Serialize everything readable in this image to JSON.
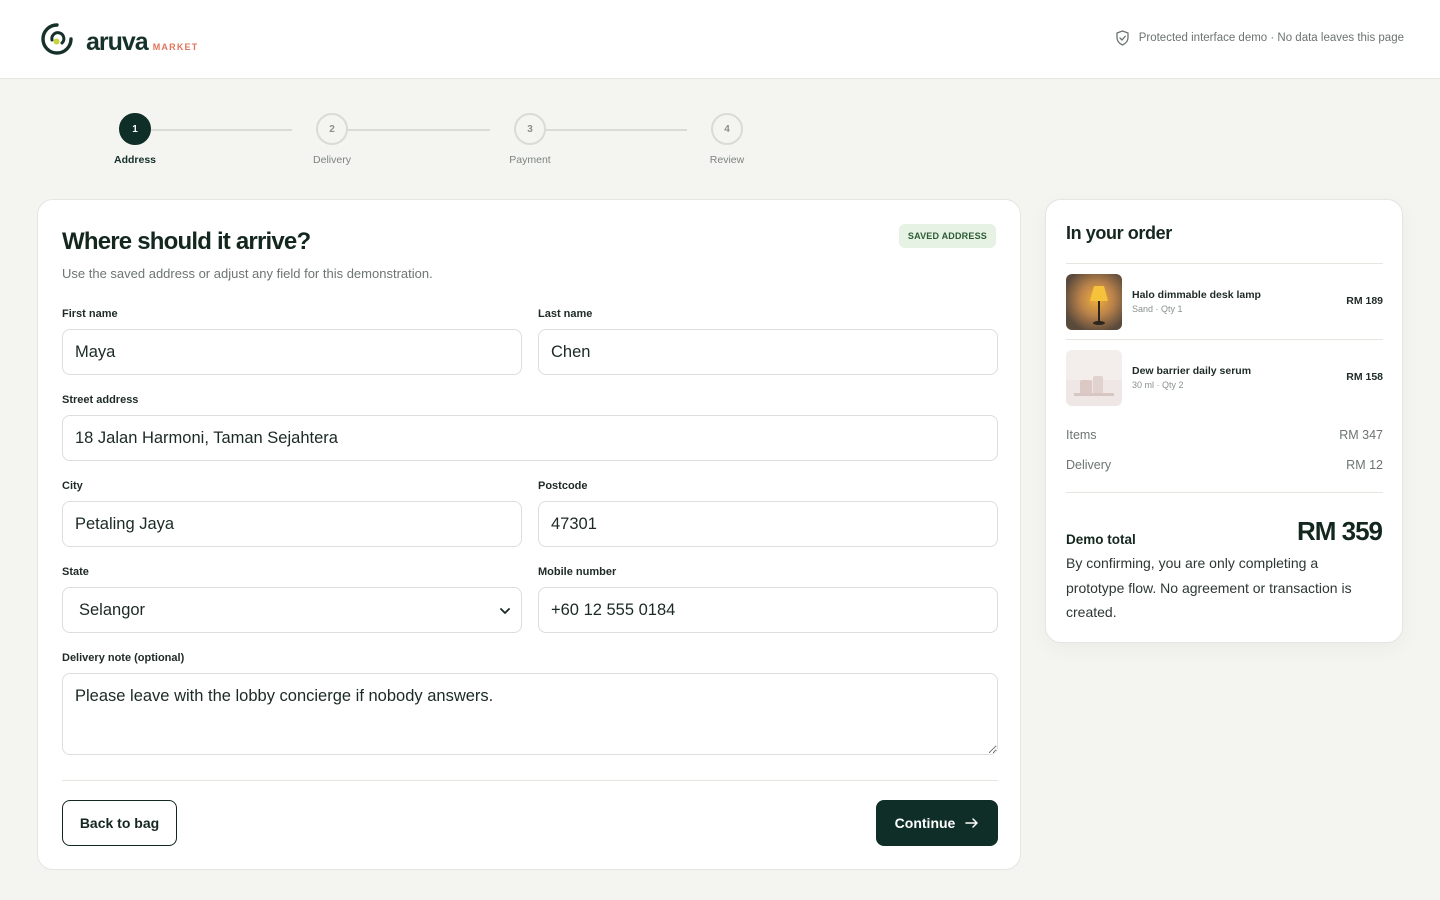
{
  "brand": {
    "name": "aruva",
    "sub": "MARKET",
    "accent": "#e0745a",
    "primary": "#0f2e27"
  },
  "header": {
    "security_note": "Protected interface demo · No data leaves this page"
  },
  "steps": [
    {
      "number": "1",
      "label": "Address",
      "active": true
    },
    {
      "number": "2",
      "label": "Delivery",
      "active": false
    },
    {
      "number": "3",
      "label": "Payment",
      "active": false
    },
    {
      "number": "4",
      "label": "Review",
      "active": false
    }
  ],
  "form": {
    "title": "Where should it arrive?",
    "subtitle": "Use the saved address or adjust any field for this demonstration.",
    "badge": "SAVED ADDRESS",
    "first_name": {
      "label": "First name",
      "value": "Maya"
    },
    "last_name": {
      "label": "Last name",
      "value": "Chen"
    },
    "street": {
      "label": "Street address",
      "value": "18 Jalan Harmoni, Taman Sejahtera"
    },
    "city": {
      "label": "City",
      "value": "Petaling Jaya"
    },
    "postcode": {
      "label": "Postcode",
      "value": "47301"
    },
    "state": {
      "label": "State",
      "value": "Selangor"
    },
    "mobile": {
      "label": "Mobile number",
      "value": "+60 12 555 0184"
    },
    "note": {
      "label": "Delivery note (optional)",
      "value": "Please leave with the lobby concierge if nobody answers."
    },
    "back_label": "Back to bag",
    "continue_label": "Continue"
  },
  "summary": {
    "title": "In your order",
    "items": [
      {
        "name": "Halo dimmable desk lamp",
        "meta": "Sand · Qty 1",
        "price": "RM 189"
      },
      {
        "name": "Dew barrier daily serum",
        "meta": "30 ml · Qty 2",
        "price": "RM 158"
      }
    ],
    "items_label": "Items",
    "items_value": "RM 347",
    "delivery_label": "Delivery",
    "delivery_value": "RM 12",
    "total_label": "Demo total",
    "total_value": "RM 359",
    "disclaimer": "By confirming, you are only completing a prototype flow. No agreement or transaction is created."
  }
}
